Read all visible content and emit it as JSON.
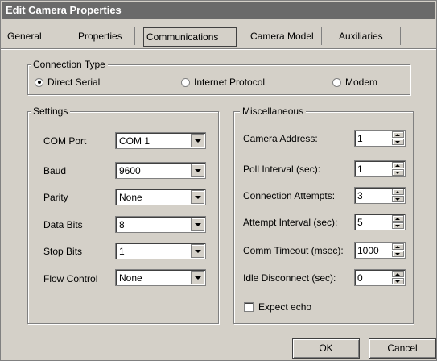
{
  "window": {
    "title": "Edit Camera Properties"
  },
  "tabs": [
    {
      "label": "General"
    },
    {
      "label": "Properties"
    },
    {
      "label": "Communications"
    },
    {
      "label": "Camera Model"
    },
    {
      "label": "Auxiliaries"
    }
  ],
  "connection_type": {
    "legend": "Connection Type",
    "options": [
      {
        "label": "Direct Serial",
        "checked": true
      },
      {
        "label": "Internet Protocol",
        "checked": false
      },
      {
        "label": "Modem",
        "checked": false
      }
    ]
  },
  "settings": {
    "legend": "Settings",
    "fields": [
      {
        "label": "COM Port",
        "value": "COM 1"
      },
      {
        "label": "Baud",
        "value": "9600"
      },
      {
        "label": "Parity",
        "value": "None"
      },
      {
        "label": "Data Bits",
        "value": "8"
      },
      {
        "label": "Stop Bits",
        "value": "1"
      },
      {
        "label": "Flow Control",
        "value": "None"
      }
    ]
  },
  "misc": {
    "legend": "Miscellaneous",
    "fields": [
      {
        "label": "Camera Address:",
        "value": "1"
      },
      {
        "label": "Poll Interval (sec):",
        "value": "1"
      },
      {
        "label": "Connection Attempts:",
        "value": "3"
      },
      {
        "label": "Attempt Interval (sec):",
        "value": "5"
      },
      {
        "label": "Comm Timeout (msec):",
        "value": "1000"
      },
      {
        "label": "Idle Disconnect (sec):",
        "value": "0"
      }
    ],
    "expect_echo": {
      "label": "Expect echo",
      "checked": false
    }
  },
  "buttons": {
    "ok": "OK",
    "cancel": "Cancel"
  }
}
